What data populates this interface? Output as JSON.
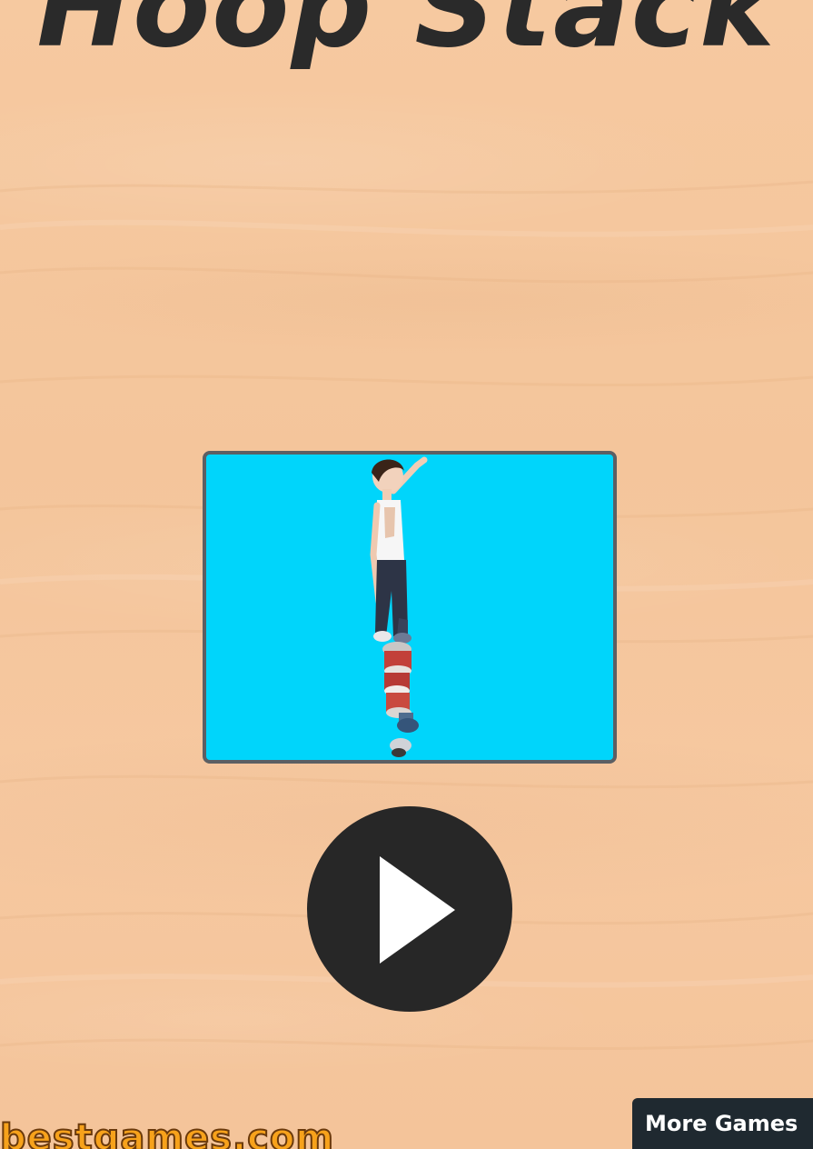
{
  "game": {
    "title": "Hoop Stack"
  },
  "preview": {
    "background_color": "#00d5fb",
    "frame_color": "#5c5f63"
  },
  "controls": {
    "play_icon": "play-icon",
    "play_color": "#272727"
  },
  "footer": {
    "brand": "bestgames.com",
    "brand_color": "#f7a21b",
    "more_games_label": "More Games"
  }
}
